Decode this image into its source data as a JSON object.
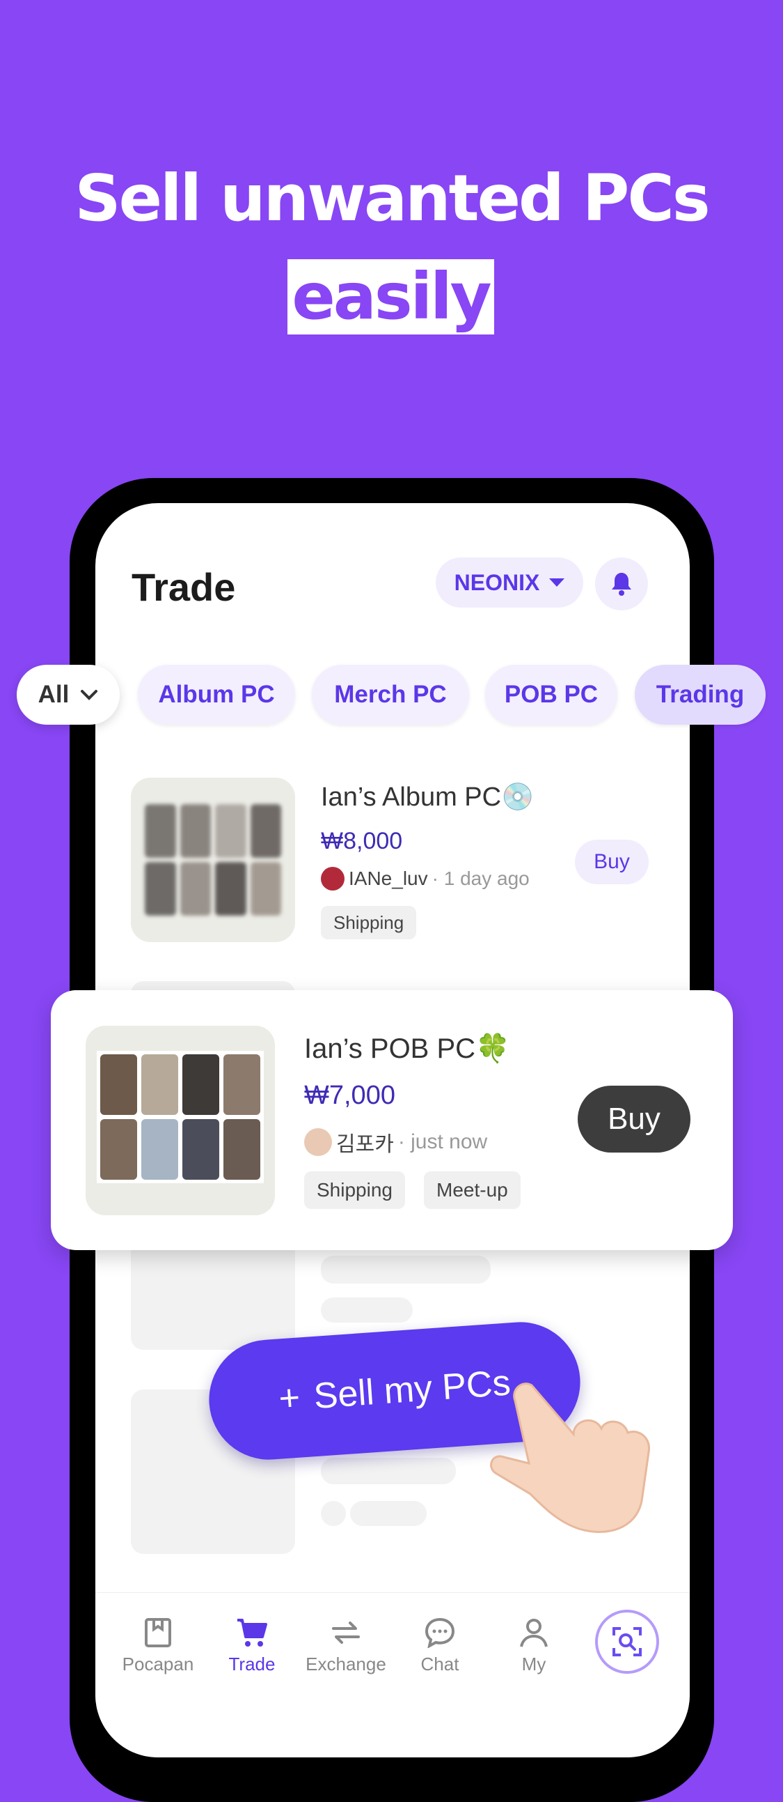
{
  "headline": {
    "line1": "Sell unwanted PCs",
    "line2": "easily"
  },
  "header": {
    "title": "Trade",
    "artist": "NEONIX"
  },
  "filters": [
    "All",
    "Album PC",
    "Merch PC",
    "POB PC",
    "Trading"
  ],
  "listing1": {
    "title": "Ian’s Album PC💿",
    "price": "₩8,000",
    "seller": "IANe_luv",
    "time": "· 1 day ago",
    "tags": [
      "Shipping"
    ],
    "buy": "Buy"
  },
  "listing2": {
    "title": "Ian’s POB PC🍀",
    "price": "₩7,000",
    "seller": "김포카",
    "time": "· just now",
    "tags": [
      "Shipping",
      "Meet-up"
    ],
    "buy": "Buy"
  },
  "sell_button": {
    "icon": "+",
    "label": "Sell my PCs"
  },
  "tabbar": [
    "Pocapan",
    "Trade",
    "Exchange",
    "Chat",
    "My"
  ],
  "colors": {
    "background": "#8846F4",
    "accent": "#5B37E8",
    "price": "#3E2BB5"
  }
}
